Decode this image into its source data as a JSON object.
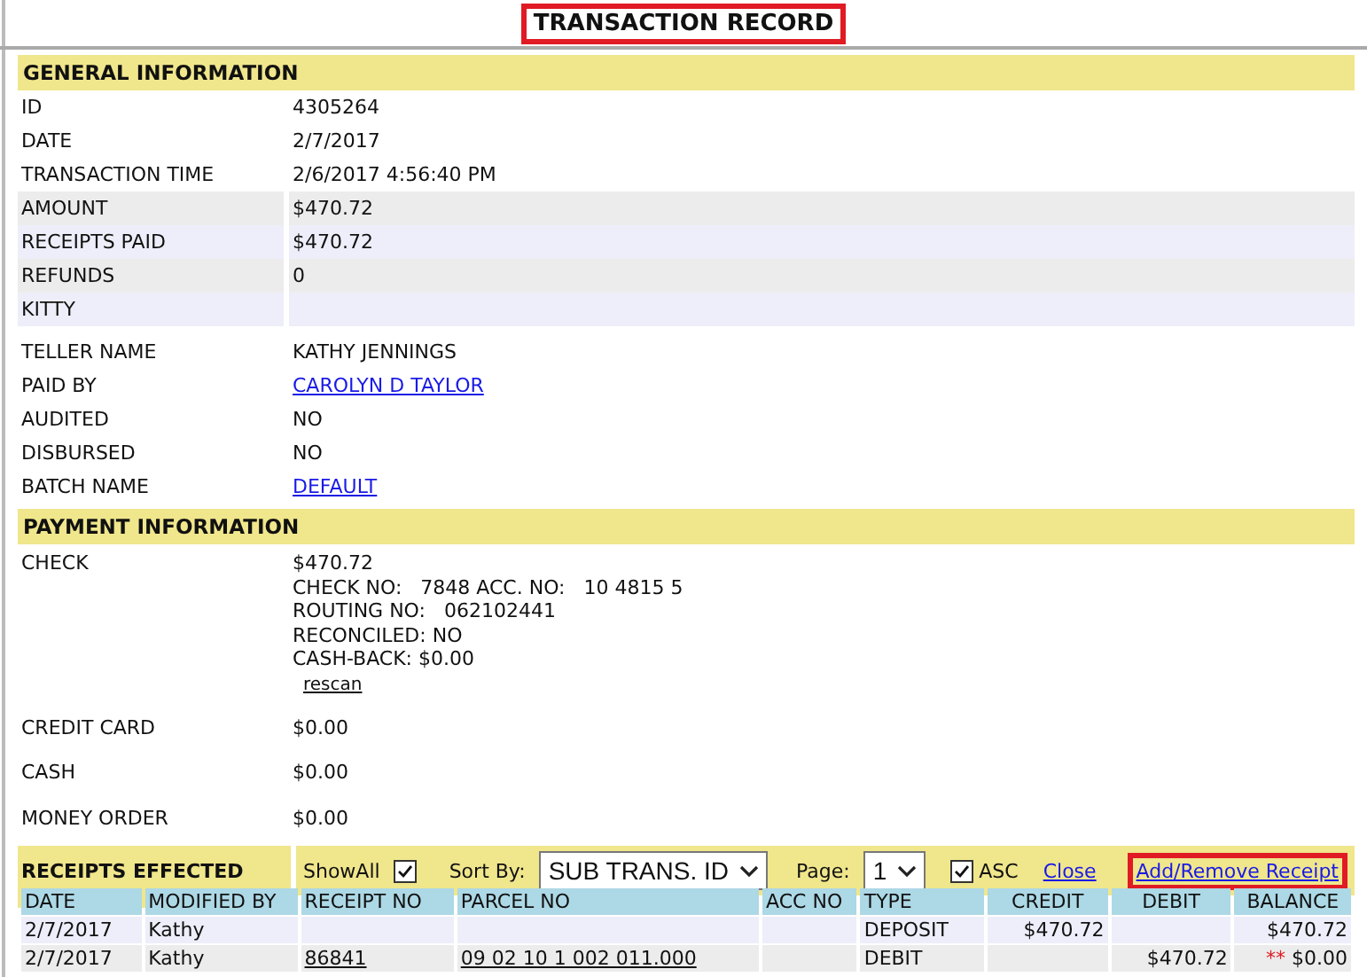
{
  "title": {
    "text": "TRANSACTION RECORD",
    "highlighted": true
  },
  "general": {
    "heading": "GENERAL INFORMATION",
    "rows": [
      {
        "label": "ID",
        "value": "4305264",
        "kind": "plain",
        "link": false
      },
      {
        "label": "DATE",
        "value": "2/7/2017",
        "kind": "plain",
        "link": false
      },
      {
        "label": "TRANSACTION TIME",
        "value": "2/6/2017 4:56:40 PM",
        "kind": "plain",
        "link": false
      },
      {
        "label": "AMOUNT",
        "value": "$470.72",
        "kind": "gray",
        "link": false
      },
      {
        "label": "RECEIPTS PAID",
        "value": "$470.72",
        "kind": "tint",
        "link": false
      },
      {
        "label": "REFUNDS",
        "value": "0",
        "kind": "gray",
        "link": false
      },
      {
        "label": "KITTY",
        "kind": "tint"
      },
      {
        "label": "TELLER NAME",
        "value": "KATHY JENNINGS",
        "kind": "plain",
        "link": false
      },
      {
        "label": "PAID BY",
        "value": "CAROLYN D TAYLOR",
        "kind": "plain",
        "link": true
      },
      {
        "label": "AUDITED",
        "value": "NO",
        "kind": "plain",
        "link": false
      },
      {
        "label": "DISBURSED",
        "value": "NO",
        "kind": "plain",
        "link": false
      },
      {
        "label": "BATCH NAME",
        "value": "DEFAULT",
        "kind": "plain",
        "link": true
      }
    ]
  },
  "payment": {
    "heading": "PAYMENT INFORMATION",
    "rows": [
      {
        "label": "CHECK",
        "lines": [
          "$470.72",
          "CHECK NO:   7848 ACC. NO:   10 4815 5",
          "ROUTING NO:   062102441",
          "RECONCILED: NO",
          "CASH-BACK: $0.00"
        ],
        "action": "rescan"
      },
      {
        "label": "CREDIT CARD",
        "lines": [
          "$0.00"
        ]
      },
      {
        "label": "CASH",
        "lines": [
          "$0.00"
        ]
      },
      {
        "label": "MONEY ORDER",
        "lines": [
          "$0.00"
        ]
      }
    ]
  },
  "receipts": {
    "heading": "RECEIPTS EFFECTED",
    "show_all": {
      "label": "ShowAll",
      "checked": true
    },
    "sort_by": {
      "label": "Sort By:",
      "value": "SUB TRANS. ID"
    },
    "page": {
      "label": "Page:",
      "value": "1"
    },
    "asc": {
      "label": "ASC",
      "checked": true
    },
    "close": "Close",
    "add_remove": {
      "text": "Add/Remove Receipt",
      "highlighted": true
    },
    "columns": [
      {
        "label": "DATE",
        "numeric": false
      },
      {
        "label": "MODIFIED BY",
        "numeric": false
      },
      {
        "label": "RECEIPT NO",
        "numeric": false
      },
      {
        "label": "PARCEL NO",
        "numeric": false
      },
      {
        "label": "ACC NO",
        "numeric": false
      },
      {
        "label": "TYPE",
        "numeric": false
      },
      {
        "label": "CREDIT",
        "numeric": true
      },
      {
        "label": "DEBIT",
        "numeric": true
      },
      {
        "label": "BALANCE",
        "numeric": true
      }
    ],
    "rows": [
      {
        "kind": "tint",
        "cells": [
          {
            "text": "2/7/2017"
          },
          {
            "text": "Kathy"
          },
          null,
          null,
          null,
          {
            "text": "DEPOSIT"
          },
          {
            "text": "$470.72"
          },
          null,
          {
            "text": "$470.72"
          }
        ]
      },
      {
        "kind": "gray",
        "cells": [
          {
            "text": "2/7/2017"
          },
          {
            "text": "Kathy"
          },
          {
            "text": "86841",
            "link": true
          },
          {
            "text": "09 02 10 1 002 011.000",
            "link": true
          },
          null,
          {
            "text": "DEBIT"
          },
          null,
          {
            "text": "$470.72"
          },
          {
            "text": "$0.00",
            "marker": "**"
          }
        ]
      }
    ]
  }
}
